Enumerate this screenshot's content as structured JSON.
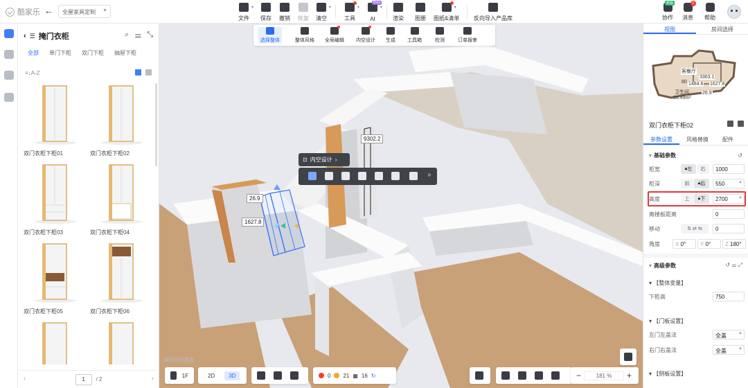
{
  "app": {
    "logo_text": "酷家乐"
  },
  "header": {
    "scene_select": "全屋家具定制",
    "tools": [
      {
        "label": "文件"
      },
      {
        "label": "保存"
      },
      {
        "label": "撤销"
      },
      {
        "label": "恢复"
      },
      {
        "label": "清空"
      },
      {
        "label": "工具"
      },
      {
        "label": "AI"
      },
      {
        "label": "渲染"
      },
      {
        "label": "图册"
      },
      {
        "label": "图纸&清单"
      },
      {
        "label": "反向导入产品库"
      }
    ],
    "ai_badge": "Beta",
    "right_tools": [
      {
        "label": "协作"
      },
      {
        "label": "消息"
      },
      {
        "label": "帮助"
      }
    ],
    "new_badge": "新版",
    "message_count": "2"
  },
  "library": {
    "title": "掩门衣柜",
    "subtabs": [
      "全部",
      "单门下柜",
      "双门下柜",
      "抽屉下柜"
    ],
    "sort_label": "A-Z",
    "items": [
      {
        "name": "双门衣柜下柜01"
      },
      {
        "name": "双门衣柜下柜02"
      },
      {
        "name": "双门衣柜下柜03"
      },
      {
        "name": "双门衣柜下柜04"
      },
      {
        "name": "双门衣柜下柜05"
      },
      {
        "name": "双门衣柜下柜06"
      },
      {
        "name": ""
      },
      {
        "name": ""
      }
    ],
    "page_current": "1",
    "page_total": "/ 2"
  },
  "viewport": {
    "toolbar": [
      {
        "label": "选择整体"
      },
      {
        "label": "整体风格"
      },
      {
        "label": "全局编辑"
      },
      {
        "label": "内空设计"
      },
      {
        "label": "生成"
      },
      {
        "label": "工具箱"
      },
      {
        "label": "检测"
      },
      {
        "label": "订单报审"
      }
    ],
    "inner_chip": "内空设计",
    "dims": {
      "top": "9302.2",
      "left": "26.9",
      "height": "1627.8"
    },
    "watermark": "酷家乐效果图",
    "bottom": {
      "floor": "1F",
      "view_2d": "2D",
      "view_3d": "3D",
      "errors": "0",
      "warnings": "21",
      "count": "16",
      "zoom": "181",
      "zoom_unit": "%"
    }
  },
  "right_panel": {
    "tabs": [
      "视图",
      "房间选择"
    ],
    "minimap_labels": {
      "room": "客餐厅",
      "area": "33.49m²",
      "dim1": "3363.1",
      "dim2": "1484.6",
      "dim3": "1627.8",
      "dim4": "26.9",
      "dim5": "80",
      "dim6": "卫生间"
    },
    "object_title": "双门衣柜下柜02",
    "subtabs": [
      "参数设置",
      "风格替换",
      "配件"
    ],
    "basic_params_title": "基础参数",
    "params": {
      "width": {
        "label": "柜宽",
        "opt1": "左",
        "opt2": "右",
        "value": "1000"
      },
      "depth": {
        "label": "柜深",
        "opt1": "前",
        "opt2": "后",
        "value": "550"
      },
      "height": {
        "label": "高度",
        "opt1": "上",
        "opt2": "下",
        "value": "2700"
      },
      "floor_gap": {
        "label": "离楼板距离",
        "value": "0"
      },
      "move": {
        "label": "移动",
        "value": "0"
      },
      "angle": {
        "label": "角度",
        "x": "0°",
        "y": "0°",
        "z": "180°",
        "x_lbl": "X",
        "y_lbl": "Y",
        "z_lbl": "Z"
      }
    },
    "advanced_title": "高级参数",
    "group1": "【整体变量】",
    "lower_height": {
      "label": "下柜高",
      "value": "750"
    },
    "group2": "【门板设置】",
    "left_door": {
      "label": "左门左盖法",
      "value": "全盖"
    },
    "right_door": {
      "label": "右门右盖法",
      "value": "全盖"
    },
    "group3": "【侧板设置】"
  },
  "colors": {
    "accent": "#2b6cf0",
    "highlight": "#e53935",
    "toolbar_dark": "#3f4247"
  }
}
